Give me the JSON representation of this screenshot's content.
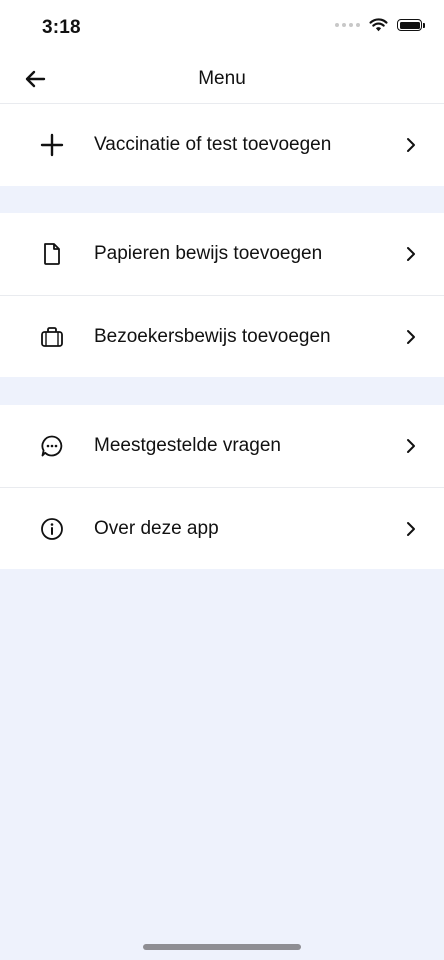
{
  "status_bar": {
    "time": "3:18",
    "icons": [
      "signal-dots-icon",
      "wifi-icon",
      "battery-icon"
    ]
  },
  "nav": {
    "title": "Menu",
    "back_icon": "arrow-left-icon"
  },
  "sections": [
    {
      "items": [
        {
          "label": "Vaccinatie of test toevoegen",
          "icon": "plus-icon"
        }
      ]
    },
    {
      "items": [
        {
          "label": "Papieren bewijs toevoegen",
          "icon": "document-icon"
        },
        {
          "label": "Bezoekersbewijs toevoegen",
          "icon": "briefcase-icon"
        }
      ]
    },
    {
      "items": [
        {
          "label": "Meestgestelde vragen",
          "icon": "chat-bubble-icon"
        },
        {
          "label": "Over deze app",
          "icon": "info-icon"
        }
      ]
    }
  ],
  "colors": {
    "background": "#EEF2FC",
    "surface": "#FFFFFF",
    "text": "#111111",
    "divider": "#E9EBEF"
  }
}
